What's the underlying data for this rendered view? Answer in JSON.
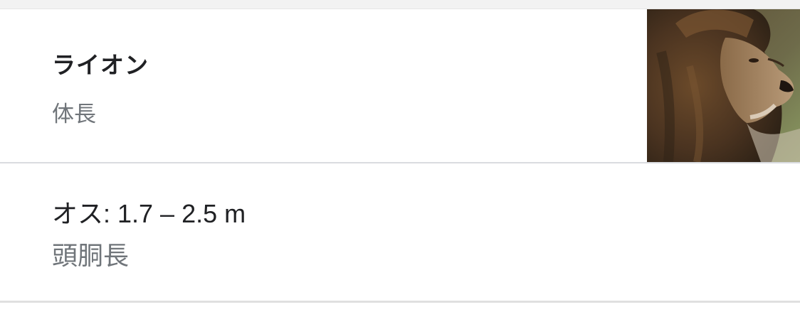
{
  "card": {
    "title": "ライオン",
    "subtitle": "体長"
  },
  "image": {
    "icon": "lion-photo"
  },
  "answer": {
    "value": "オス: 1.7 – 2.5 m",
    "label": "頭胴長"
  },
  "colors": {
    "title": "#202124",
    "secondary": "#70757a",
    "divider": "#dadce0"
  }
}
